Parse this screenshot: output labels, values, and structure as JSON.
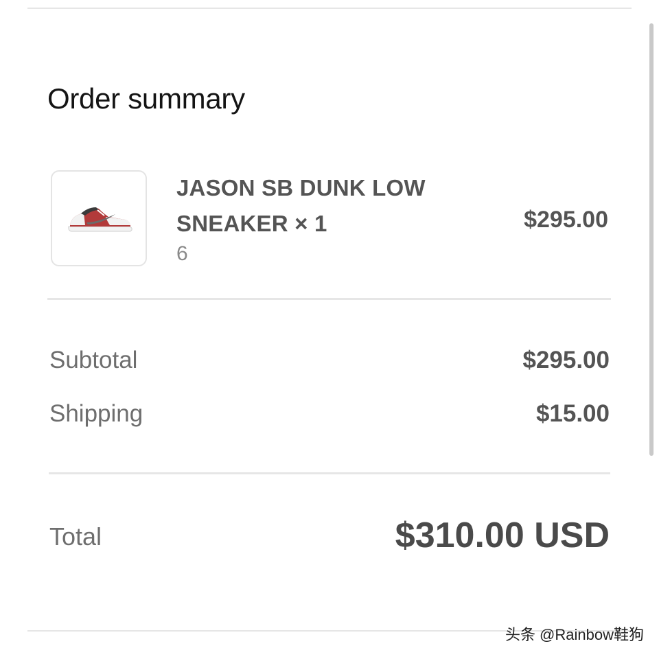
{
  "summary": {
    "title": "Order summary"
  },
  "item": {
    "name": "JASON SB DUNK LOW SNEAKER × 1",
    "variant": "6",
    "price": "$295.00",
    "thumbnail_icon": "sneaker-icon",
    "colors": {
      "shoe_red": "#b23a3a",
      "shoe_white": "#f2f2f2",
      "shoe_gray": "#6b6b6b"
    }
  },
  "costs": {
    "subtotal_label": "Subtotal",
    "subtotal_value": "$295.00",
    "shipping_label": "Shipping",
    "shipping_value": "$15.00"
  },
  "total": {
    "label": "Total",
    "value": "$310.00 USD"
  },
  "watermark": {
    "text": "头条 @Rainbow鞋狗"
  }
}
